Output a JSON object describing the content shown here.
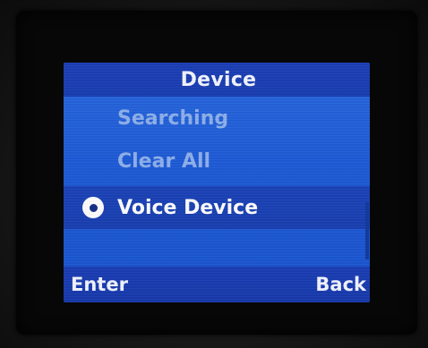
{
  "screen": {
    "title": "Device",
    "menu": {
      "items": [
        {
          "label": "Searching",
          "state": "disabled"
        },
        {
          "label": "Clear All",
          "state": "disabled"
        },
        {
          "label": "Voice Device",
          "state": "selected",
          "icon": "radio-selected-icon"
        }
      ]
    },
    "softkeys": {
      "left": "Enter",
      "right": "Back"
    }
  },
  "colors": {
    "screen_bg": "#1f5cd8",
    "bar_bg": "#1a3eb2",
    "disabled_text": "#8fb1ec",
    "text": "#ffffff"
  }
}
